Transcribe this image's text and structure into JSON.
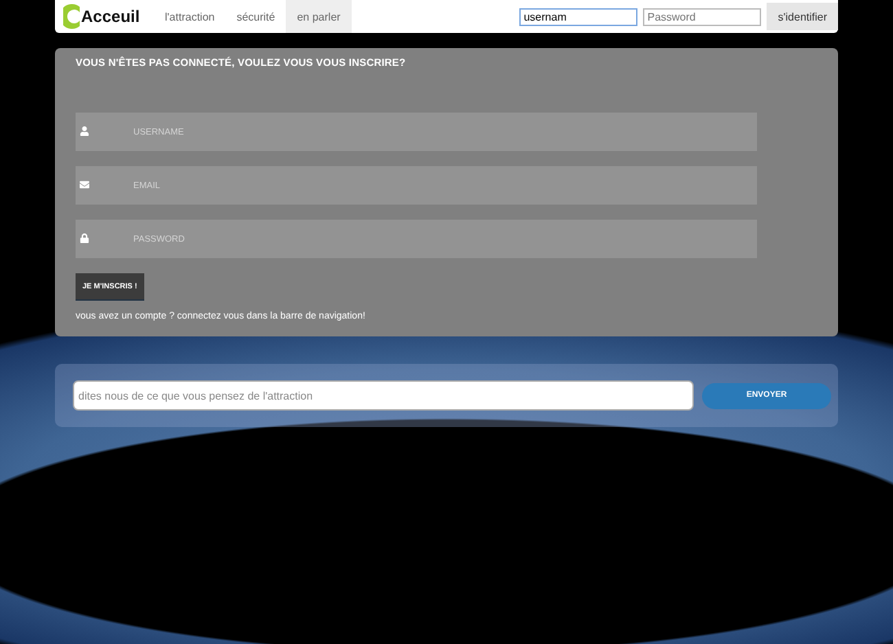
{
  "navbar": {
    "logo": "Acceuil",
    "links": [
      {
        "label": "l'attraction",
        "selected": false
      },
      {
        "label": "sécurité",
        "selected": false
      },
      {
        "label": "en parler",
        "selected": true
      }
    ],
    "login": {
      "username": "usernam",
      "password_placeholder": "Password",
      "button": "s'identifier"
    }
  },
  "signup": {
    "title": "VOUS N'ÊTES PAS CONNECTÉ, VOULEZ VOUS VOUS INSCRIRE?",
    "fields": [
      {
        "kind": "user",
        "placeholder": "USERNAME"
      },
      {
        "kind": "mail",
        "placeholder": "EMAIL"
      },
      {
        "kind": "lock",
        "placeholder": "PASSWORD"
      }
    ],
    "button": "JE M'INSCRIS !",
    "note": "vous avez un compte ? connectez vous dans la barre de navigation!"
  },
  "feedback": {
    "placeholder": "dites nous de ce que vous pensez de l'attraction",
    "button": "ENVOYER"
  }
}
